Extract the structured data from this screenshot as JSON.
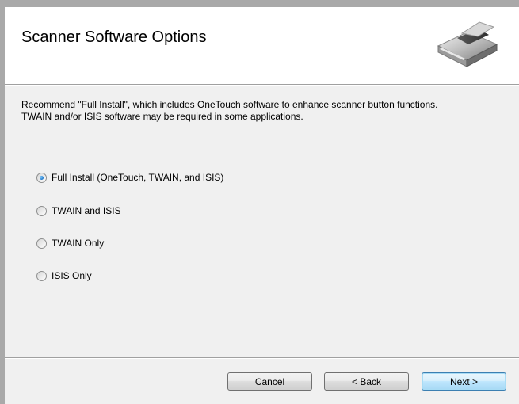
{
  "window": {
    "title": "Scanner Software Options"
  },
  "description": {
    "line1": "Recommend \"Full Install\", which includes OneTouch software to enhance scanner button functions.",
    "line2": "TWAIN and/or ISIS software may be required in some applications."
  },
  "options": [
    {
      "label": "Full Install (OneTouch, TWAIN, and ISIS)",
      "selected": true
    },
    {
      "label": "TWAIN and ISIS",
      "selected": false
    },
    {
      "label": "TWAIN Only",
      "selected": false
    },
    {
      "label": "ISIS Only",
      "selected": false
    }
  ],
  "buttons": {
    "cancel": "Cancel",
    "back": "< Back",
    "next": "Next >"
  },
  "icons": {
    "header": "scanner-icon",
    "radio_selected": "radio-selected-icon",
    "radio_unselected": "radio-unselected-icon"
  },
  "colors": {
    "frame": "#a9a9a9",
    "panel": "#f0f0f0",
    "header_bg": "#ffffff",
    "default_button_border": "#3c7fb1"
  }
}
